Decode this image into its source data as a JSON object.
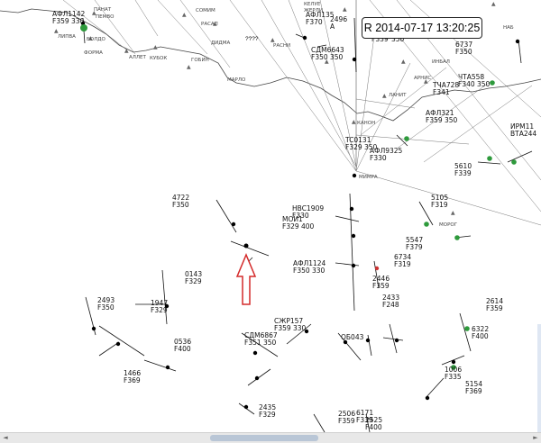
{
  "header": {
    "timestamp": "R 2014-07-17 13:20:25"
  },
  "geo_labels": [
    "ПАНАТ",
    "ПЕМВО",
    "ЛИПВА",
    "БОЛДО",
    "ФОРМА",
    "АЛЛЕТ",
    "КУБОК",
    "СОМИМ",
    "РАСАП",
    "ДИДМА",
    "ГОБИН",
    "РАСНИ",
    "ЖЕРЛИ",
    "МАРЛО",
    "????",
    "КЕЛУЕ",
    "ИНБАЛ",
    "АРНИС",
    "ЛАНИТ",
    "КАНОН",
    "МИМРА",
    "МОРОГ",
    "НАБ"
  ],
  "flights": [
    {
      "line1": "АФЛ1142",
      "line2": "F359  330"
    },
    {
      "line1": "АФЛ135",
      "line2": "F370"
    },
    {
      "line1": "2496",
      "line2": "A"
    },
    {
      "line1": "СДМ6643",
      "line2": "F350  350"
    },
    {
      "line1": "6737",
      "line2": "F350"
    },
    {
      "line1": "F339",
      "line2": "350"
    },
    {
      "line1": "ЧТА558",
      "line2": "F340  350"
    },
    {
      "line1": "ТЧА728",
      "line2": "F341"
    },
    {
      "line1": "АФЛ321",
      "line2": "F359  350"
    },
    {
      "line1": "ИРМ11",
      "line2": "ВТА244"
    },
    {
      "line1": "TC0131",
      "line2": "F329  350"
    },
    {
      "line1": "АФЛ9325",
      "line2": "F330"
    },
    {
      "line1": "5610",
      "line2": "F339"
    },
    {
      "line1": "4722",
      "line2": "F350"
    },
    {
      "line1": "НВС1909",
      "line2": "F330"
    },
    {
      "line1": "МОИ1",
      "line2": "F329  400"
    },
    {
      "line1": "5105",
      "line2": "F319"
    },
    {
      "line1": "5547",
      "line2": "F379"
    },
    {
      "line1": "АФЛ1124",
      "line2": "F350  330"
    },
    {
      "line1": "6734",
      "line2": "F319"
    },
    {
      "line1": "0143",
      "line2": "F329"
    },
    {
      "line1": "2446",
      "line2": "F359"
    },
    {
      "line1": "2433",
      "line2": "F248"
    },
    {
      "line1": "2493",
      "line2": "F350"
    },
    {
      "line1": "1947",
      "line2": "F329"
    },
    {
      "line1": "2614",
      "line2": "F359"
    },
    {
      "line1": "СЖР157",
      "line2": "F359  330"
    },
    {
      "line1": "СДМ6867",
      "line2": "F351  350"
    },
    {
      "line1": "0536",
      "line2": "F400"
    },
    {
      "line1": "ОБ043",
      "line2": ""
    },
    {
      "line1": "6322",
      "line2": "F400"
    },
    {
      "line1": "1466",
      "line2": "F369"
    },
    {
      "line1": "1006",
      "line2": "F335"
    },
    {
      "line1": "5154",
      "line2": "F369"
    },
    {
      "line1": "2435",
      "line2": "F329"
    },
    {
      "line1": "2506",
      "line2": "F359"
    },
    {
      "line1": "6171",
      "line2": "F339"
    },
    {
      "line1": "2525",
      "line2": "F400"
    }
  ],
  "colors": {
    "track_green": "#2e9a3c",
    "arrow_red": "#d42a2a",
    "coast": "#444444"
  }
}
